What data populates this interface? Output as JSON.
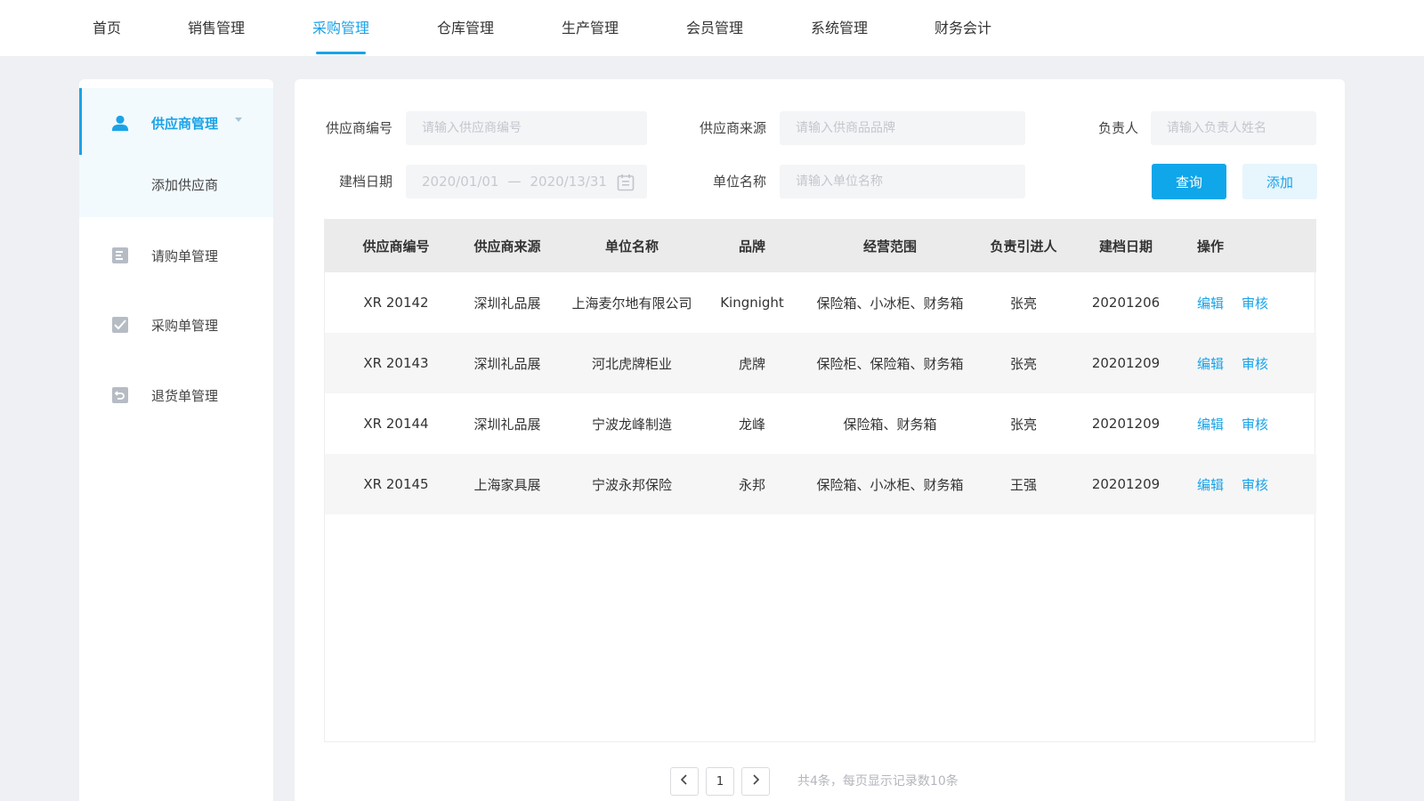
{
  "nav": {
    "items": [
      {
        "label": "首页"
      },
      {
        "label": "销售管理"
      },
      {
        "label": "采购管理",
        "active": true
      },
      {
        "label": "仓库管理"
      },
      {
        "label": "生产管理"
      },
      {
        "label": "会员管理"
      },
      {
        "label": "系统管理"
      },
      {
        "label": "财务会计"
      }
    ]
  },
  "sidebar": {
    "supplier_mgmt": {
      "label": "供应商管理",
      "icon": "user-icon"
    },
    "add_supplier": {
      "label": "添加供应商"
    },
    "items": [
      {
        "label": "请购单管理",
        "icon": "requisition-icon"
      },
      {
        "label": "采购单管理",
        "icon": "purchase-order-icon"
      },
      {
        "label": "退货单管理",
        "icon": "return-icon"
      }
    ]
  },
  "filters": {
    "supplier_code": {
      "label": "供应商编号",
      "placeholder": "请输入供应商编号"
    },
    "supplier_source": {
      "label": "供应商来源",
      "placeholder": "请输入供商品品牌"
    },
    "owner": {
      "label": "负责人",
      "placeholder": "请输入负责人姓名"
    },
    "create_date": {
      "label": "建档日期",
      "start": "2020/01/01",
      "sep": "一",
      "end": "2020/13/31"
    },
    "unit_name": {
      "label": "单位名称",
      "placeholder": "请输入单位名称"
    },
    "query_label": "查询",
    "add_label": "添加"
  },
  "table": {
    "columns": [
      "供应商编号",
      "供应商来源",
      "单位名称",
      "品牌",
      "经营范围",
      "负责引进人",
      "建档日期",
      "操作"
    ],
    "rows": [
      {
        "code": "XR 20142",
        "source": "深圳礼品展",
        "unit": "上海麦尔地有限公司",
        "brand": "Kingnight",
        "scope": "保险箱、小冰柜、财务箱",
        "owner": "张亮",
        "date": "20201206"
      },
      {
        "code": "XR 20143",
        "source": "深圳礼品展",
        "unit": "河北虎牌柜业",
        "brand": "虎牌",
        "scope": "保险柜、保险箱、财务箱",
        "owner": "张亮",
        "date": "20201209"
      },
      {
        "code": "XR 20144",
        "source": "深圳礼品展",
        "unit": "宁波龙峰制造",
        "brand": "龙峰",
        "scope": "保险箱、财务箱",
        "owner": "张亮",
        "date": "20201209"
      },
      {
        "code": "XR 20145",
        "source": "上海家具展",
        "unit": "宁波永邦保险",
        "brand": "永邦",
        "scope": "保险箱、小冰柜、财务箱",
        "owner": "王强",
        "date": "20201209"
      }
    ],
    "edit_label": "编辑",
    "review_label": "审核"
  },
  "pagination": {
    "current_page": "1",
    "summary": "共4条，每页显示记录数10条"
  },
  "colors": {
    "accent": "#1aa3e8",
    "primary_button": "#10a6ea",
    "background": "#eef0f3"
  }
}
